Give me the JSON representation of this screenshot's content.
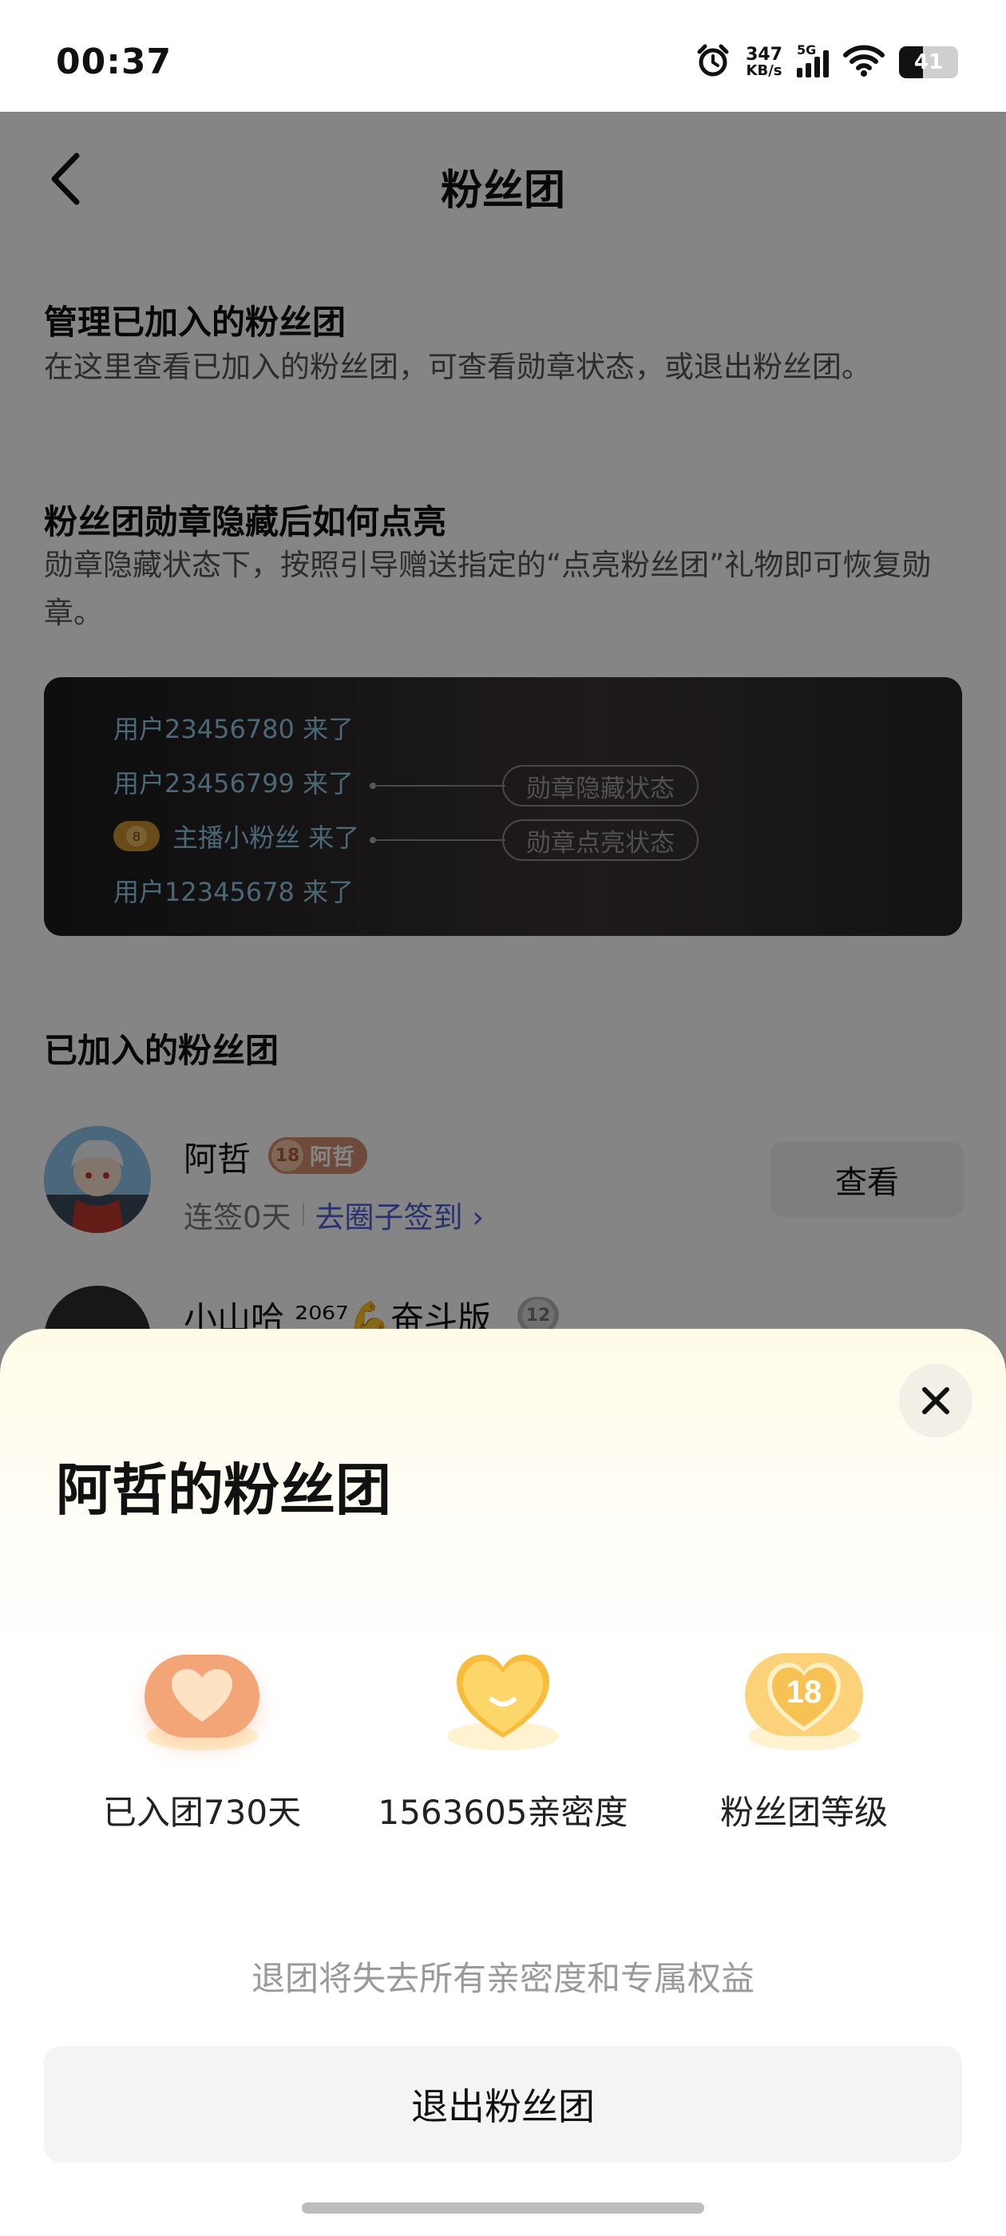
{
  "status_bar": {
    "time": "00:37",
    "speed_value": "347",
    "speed_unit": "KB/s",
    "network": "5G",
    "battery": "41",
    "battery_level": 0.41
  },
  "nav": {
    "title": "粉丝团"
  },
  "sections": {
    "manage_title": "管理已加入的粉丝团",
    "manage_desc": "在这里查看已加入的粉丝团，可查看勋章状态，或退出粉丝团。",
    "relight_title": "粉丝团勋章隐藏后如何点亮",
    "relight_desc": "勋章隐藏状态下，按照引导赠送指定的“点亮粉丝团”礼物即可恢复勋章。",
    "joined_title": "已加入的粉丝团"
  },
  "demo": {
    "line1": "用户23456780 来了",
    "line2": "用户23456799 来了",
    "line3_badge": "8",
    "line3": "主播小粉丝 来了",
    "line4": "用户12345678 来了",
    "hidden_label": "勋章隐藏状态",
    "lit_label": "勋章点亮状态"
  },
  "joined": [
    {
      "name": "阿哲",
      "badge_level": "18",
      "badge_name": "阿哲",
      "streak": "连签0天",
      "checkin_link": "去圈子签到 ›",
      "view_label": "查看"
    },
    {
      "name": "小山哈 ²⁰⁶⁷💪奋斗版",
      "badge_level": "12"
    }
  ],
  "sheet": {
    "title": "阿哲的粉丝团",
    "stats": [
      {
        "icon": "heart-icon",
        "label": "已入团730天"
      },
      {
        "icon": "smile-heart-icon",
        "label": "1563605亲密度"
      },
      {
        "icon": "level-heart-icon",
        "value": "18",
        "label": "粉丝团等级"
      }
    ],
    "warning": "退团将失去所有亲密度和专属权益",
    "leave_label": "退出粉丝团"
  },
  "colors": {
    "link": "#4e5fd6",
    "badge": "#d28e6d",
    "heart_orange": "#f3a578",
    "heart_yellow": "#f7bd3b"
  }
}
